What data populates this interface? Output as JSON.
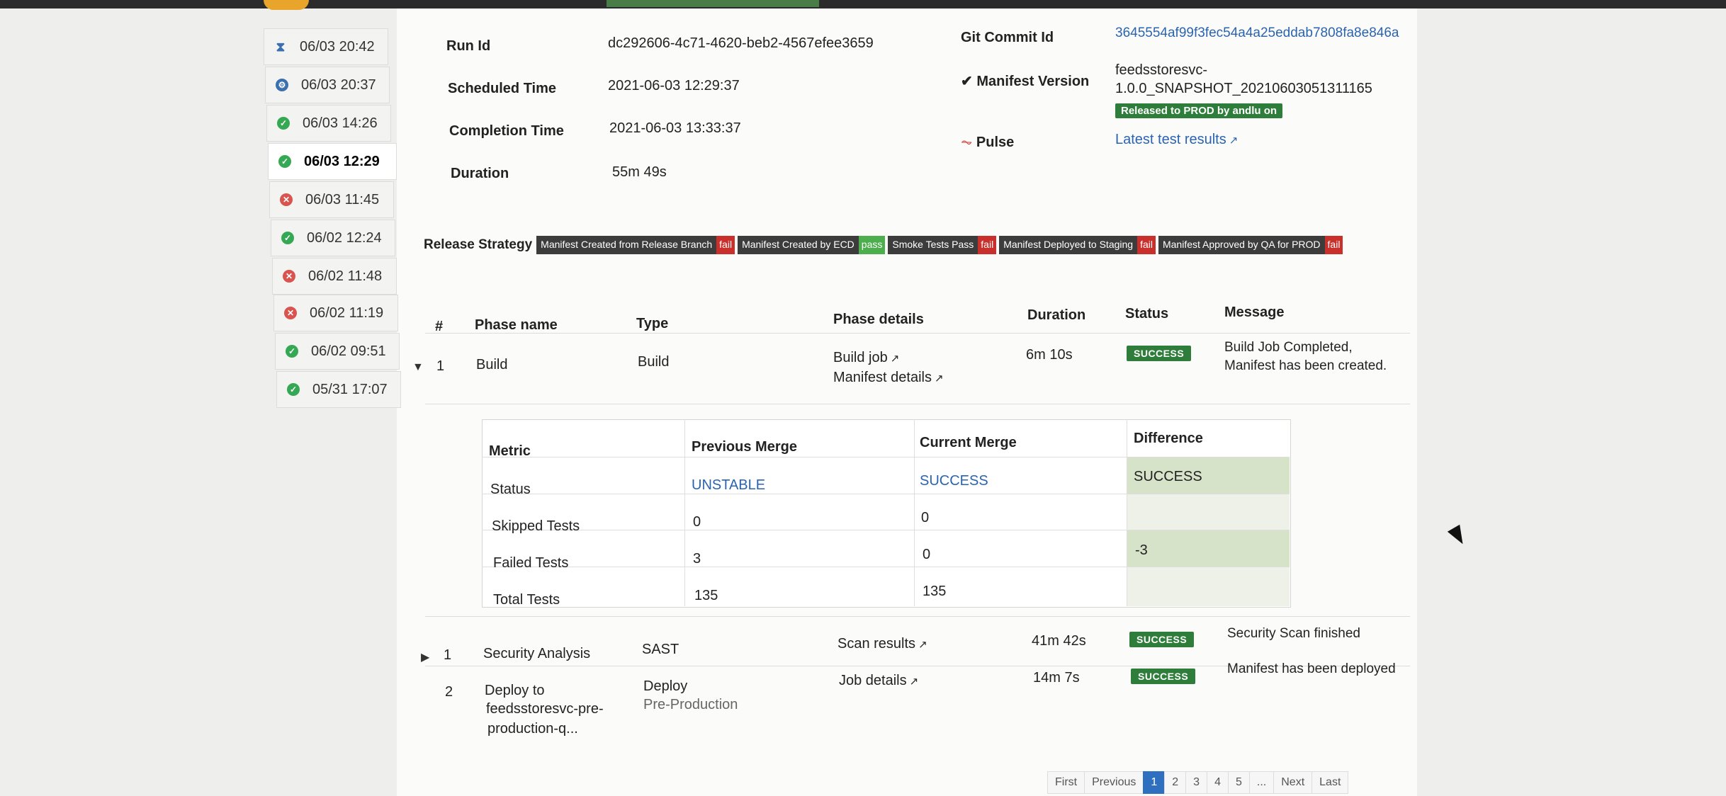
{
  "sidebar": {
    "runs": [
      {
        "time": "06/03 20:42",
        "status": "waiting",
        "icon": "hourglass-icon"
      },
      {
        "time": "06/03 20:37",
        "status": "running",
        "icon": "gear-icon"
      },
      {
        "time": "06/03 14:26",
        "status": "success",
        "icon": "check-circle-icon"
      },
      {
        "time": "06/03 12:29",
        "status": "success",
        "icon": "check-circle-icon"
      },
      {
        "time": "06/03 11:45",
        "status": "failed",
        "icon": "x-circle-icon"
      },
      {
        "time": "06/02 12:24",
        "status": "success",
        "icon": "check-circle-icon"
      },
      {
        "time": "06/02 11:48",
        "status": "failed",
        "icon": "x-circle-icon"
      },
      {
        "time": "06/02 11:19",
        "status": "failed",
        "icon": "x-circle-icon"
      },
      {
        "time": "06/02 09:51",
        "status": "success",
        "icon": "check-circle-icon"
      },
      {
        "time": "05/31 17:07",
        "status": "success",
        "icon": "check-circle-icon"
      }
    ]
  },
  "details": {
    "run_id_label": "Run Id",
    "run_id": "dc292606-4c71-4620-beb2-4567efee3659",
    "scheduled_label": "Scheduled Time",
    "scheduled": "2021-06-03 12:29:37",
    "completion_label": "Completion Time",
    "completion": "2021-06-03 13:33:37",
    "duration_label": "Duration",
    "duration": "55m 49s",
    "git_label": "Git Commit Id",
    "git_commit": "3645554af99f3fec54a4a25eddab7808fa8e846a",
    "manifest_label": "Manifest Version",
    "manifest_line1": "feedsstoresvc-",
    "manifest_line2": "1.0.0_SNAPSHOT_20210603051311165",
    "released_badge": "Released to PROD by andlu on",
    "pulse_label": "Pulse",
    "latest_results": "Latest test results"
  },
  "strategy": {
    "title": "Release Strategy",
    "chips": [
      {
        "name": "Manifest Created from Release Branch",
        "status": "fail"
      },
      {
        "name": "Manifest Created by ECD",
        "status": "pass"
      },
      {
        "name": "Smoke Tests Pass",
        "status": "fail"
      },
      {
        "name": "Manifest Deployed to Staging",
        "status": "fail"
      },
      {
        "name": "Manifest Approved by QA for PROD",
        "status": "fail"
      }
    ]
  },
  "phases": {
    "headers": {
      "num": "#",
      "name": "Phase name",
      "type": "Type",
      "details": "Phase details",
      "duration": "Duration",
      "status": "Status",
      "message": "Message"
    },
    "rows": [
      {
        "num": "1",
        "name": "Build",
        "type": "Build",
        "link1": "Build job",
        "link2": "Manifest details",
        "duration": "6m 10s",
        "status": "SUCCESS",
        "msg1": "Build Job Completed,",
        "msg2": "Manifest has been created."
      },
      {
        "num": "1",
        "name": "Security Analysis",
        "type": "SAST",
        "link1": "Scan results",
        "duration": "41m 42s",
        "status": "SUCCESS",
        "msg1": "Security Scan finished"
      },
      {
        "num": "2",
        "name1": "Deploy to",
        "name2": "feedsstoresvc-pre-",
        "name3": "production-q...",
        "type": "Deploy",
        "type2": "Pre-Production",
        "link1": "Job details",
        "duration": "14m 7s",
        "status": "SUCCESS",
        "msg1": "Manifest has been deployed"
      }
    ]
  },
  "metrics": {
    "headers": {
      "metric": "Metric",
      "prev": "Previous Merge",
      "curr": "Current Merge",
      "diff": "Difference"
    },
    "rows": [
      {
        "metric": "Status",
        "prev": "UNSTABLE",
        "curr": "SUCCESS",
        "diff": "SUCCESS"
      },
      {
        "metric": "Skipped Tests",
        "prev": "0",
        "curr": "0",
        "diff": ""
      },
      {
        "metric": "Failed Tests",
        "prev": "3",
        "curr": "0",
        "diff": "-3"
      },
      {
        "metric": "Total Tests",
        "prev": "135",
        "curr": "135",
        "diff": ""
      }
    ]
  },
  "pagination": {
    "first": "First",
    "previous": "Previous",
    "pages": [
      "1",
      "2",
      "3",
      "4",
      "5",
      "..."
    ],
    "next": "Next",
    "last": "Last"
  }
}
